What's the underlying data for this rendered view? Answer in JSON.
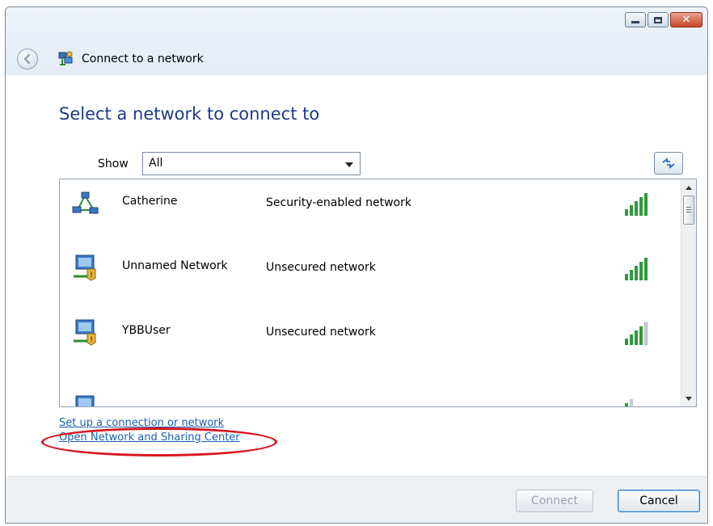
{
  "window": {
    "title": "Connect to a network",
    "caption_buttons": [
      "minimize-icon",
      "maximize-icon",
      "close-icon"
    ]
  },
  "heading": "Select a network to connect to",
  "filter": {
    "label": "Show",
    "selected": "All"
  },
  "networks": [
    {
      "name": "Catherine",
      "security": "Security-enabled network",
      "icon": "ad-hoc-network-icon",
      "signal_bars": 5
    },
    {
      "name": "Unnamed Network",
      "security": "Unsecured network",
      "icon": "unsecured-network-icon",
      "signal_bars": 5
    },
    {
      "name": "YBBUser",
      "security": "Unsecured network",
      "icon": "unsecured-network-icon",
      "signal_bars": 4
    },
    {
      "name": "",
      "security": "",
      "icon": "network-icon",
      "signal_bars": 1
    }
  ],
  "links": {
    "setup": "Set up a connection or network",
    "sharing_center": "Open Network and Sharing Center"
  },
  "buttons": {
    "connect": "Connect",
    "cancel": "Cancel"
  },
  "colors": {
    "heading": "#1e3b8a",
    "link": "#1a5fb4",
    "annotation": "#d9141e",
    "signal": "#2f9a3b"
  }
}
